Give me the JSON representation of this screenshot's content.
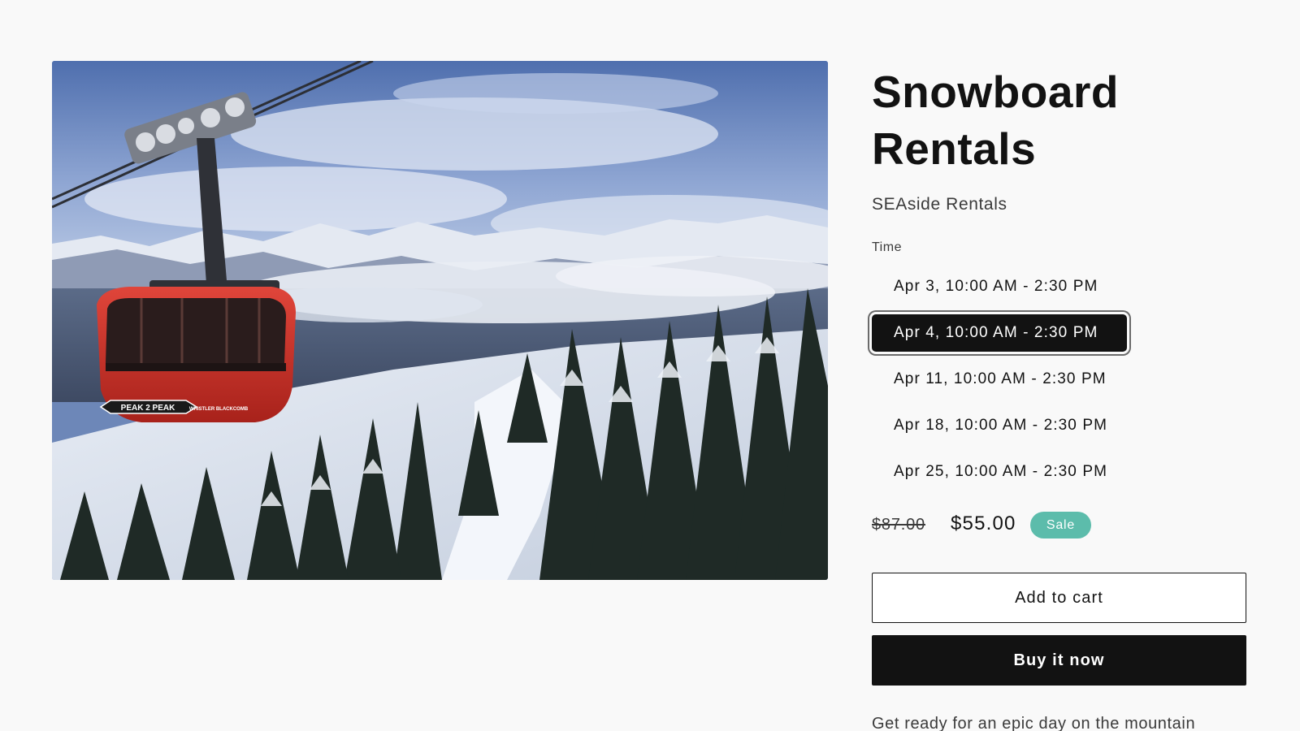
{
  "product": {
    "image_alt": "Red Peak 2 Peak gondola over snowy forested mountains",
    "gondola_text": "PEAK 2 PEAK",
    "gondola_subtext": "WHISTLER BLACKCOMB",
    "title_line1": "Snowboard",
    "title_line2": "Rentals",
    "vendor": "SEAside Rentals",
    "time_label": "Time",
    "times": [
      {
        "label": "Apr 3, 10:00 AM - 2:30 PM",
        "selected": false
      },
      {
        "label": "Apr 4, 10:00 AM - 2:30 PM",
        "selected": true
      },
      {
        "label": "Apr 11, 10:00 AM - 2:30 PM",
        "selected": false
      },
      {
        "label": "Apr 18, 10:00 AM - 2:30 PM",
        "selected": false
      },
      {
        "label": "Apr 25, 10:00 AM - 2:30 PM",
        "selected": false
      }
    ],
    "price_regular": "$87.00",
    "price_sale": "$55.00",
    "sale_badge": "Sale",
    "add_to_cart_label": "Add to cart",
    "buy_now_label": "Buy it now",
    "description": "Get ready for an epic day on the mountain"
  },
  "colors": {
    "background": "#f9f9f9",
    "text": "#121212",
    "sale_badge": "#5cbcab",
    "selected_option": "#121212"
  }
}
